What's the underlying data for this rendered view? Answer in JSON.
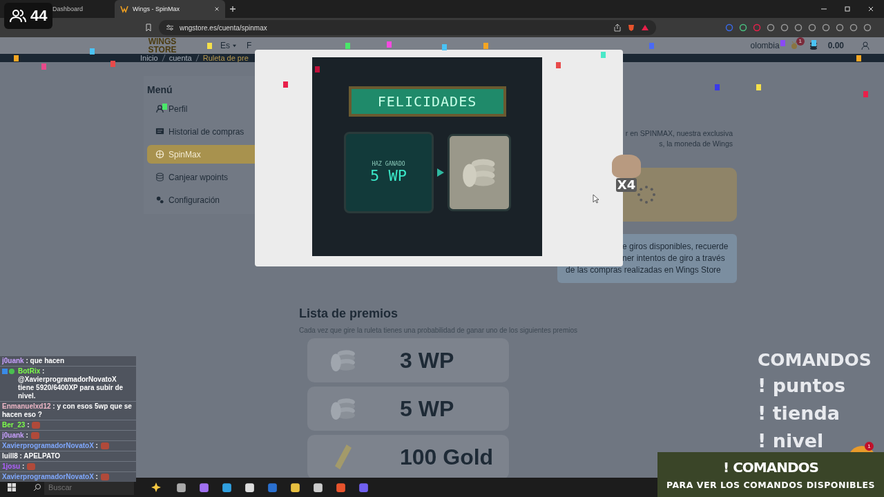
{
  "stream_overlay": {
    "viewer_count": "44"
  },
  "browser": {
    "tabs": [
      {
        "title": "Dashboard",
        "selected": false
      },
      {
        "title": "Wings - SpinMax",
        "selected": true
      }
    ],
    "address": "wngstore.es/cuenta/spinmax"
  },
  "site_header": {
    "logo": "WINGS STORE",
    "language": "Es",
    "nav_item": "F",
    "country": "olombia",
    "notification_count": "1",
    "balance": "0.00"
  },
  "breadcrumb": [
    "Inicio",
    "cuenta",
    "Ruleta de pre"
  ],
  "menu": {
    "title": "Menú",
    "items": [
      {
        "label": "Perfil",
        "selected": false
      },
      {
        "label": "Historial de compras",
        "selected": false
      },
      {
        "label": "SpinMax",
        "selected": true
      },
      {
        "label": "Canjear wpoints",
        "selected": false
      },
      {
        "label": "Configuración",
        "selected": false
      }
    ]
  },
  "spin_panel": {
    "intro_lines": [
      "r en SPINMAX, nuestra exclusiva",
      "s, la moneda de Wings"
    ],
    "info_lines": [
      "e giros disponibles, recuerde",
      "ner intentos de giro a través",
      "de las compras realizadas en Wings Store"
    ]
  },
  "prizes": {
    "title": "Lista de premios",
    "subtitle": "Cada vez que gire la ruleta tienes una probabilidad de ganar uno de los siguientes premios",
    "items": [
      {
        "label": "3 WP",
        "kind": "coins"
      },
      {
        "label": "5 WP",
        "kind": "coins"
      },
      {
        "label": "100 Gold",
        "kind": "gold"
      }
    ]
  },
  "prize_modal": {
    "banner": "FELICIDADES",
    "caption": "HAZ GANADO",
    "prize": "5 WP"
  },
  "emote_overlay": {
    "multiplier": "X4"
  },
  "chat": [
    {
      "user": "j0uank",
      "color": "#c8a0ff",
      "kind": "text",
      "text": ": que hacen",
      "badges": false
    },
    {
      "user": "BotRix",
      "color": "#7cff4a",
      "kind": "text",
      "text": ": @XavierprogramadorNovatoX tiene 5920/6400XP para subir de nivel.",
      "badges": true
    },
    {
      "user": "Enmanuelxd12",
      "color": "#f0b8c8",
      "kind": "text",
      "text": ": y con esos 5wp que se hacen eso ?",
      "badges": false
    },
    {
      "user": "Ber_23",
      "color": "#7cff4a",
      "kind": "emote",
      "text": ":",
      "badges": false
    },
    {
      "user": "j0uank",
      "color": "#c8a0ff",
      "kind": "emote",
      "text": ":",
      "badges": false
    },
    {
      "user": "XavierprogramadorNovatoX",
      "color": "#7fa8ff",
      "kind": "emote",
      "text": ":",
      "badges": false
    },
    {
      "user": "luill8",
      "color": "#ffffff",
      "kind": "text",
      "text": ": APELPATO",
      "badges": false
    },
    {
      "user": "1josu",
      "color": "#b060ff",
      "kind": "emote",
      "text": ":",
      "badges": false
    },
    {
      "user": "XavierprogramadorNovatoX",
      "color": "#7fa8ff",
      "kind": "emote",
      "text": ":",
      "badges": false
    }
  ],
  "commands": {
    "title": "COMANDOS",
    "items": [
      "! puntos",
      "! tienda",
      "! nivel"
    ],
    "notification_count": "1"
  },
  "commands_banner": {
    "title": "! COMANDOS",
    "subtitle": "PARA VER LOS COMANDOS DISPONIBLES"
  },
  "taskbar": {
    "search_placeholder": "Buscar"
  }
}
